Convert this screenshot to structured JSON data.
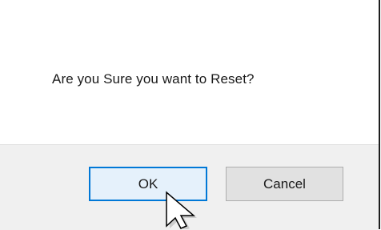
{
  "dialog": {
    "message": "Are you Sure you want to Reset?",
    "buttons": {
      "ok_label": "OK",
      "cancel_label": "Cancel"
    }
  },
  "cursor": {
    "icon": "arrow-pointer-icon"
  },
  "colors": {
    "focus_border": "#0078d7",
    "button_bar": "#f0f0f0",
    "button_face": "#e1e1e1"
  }
}
